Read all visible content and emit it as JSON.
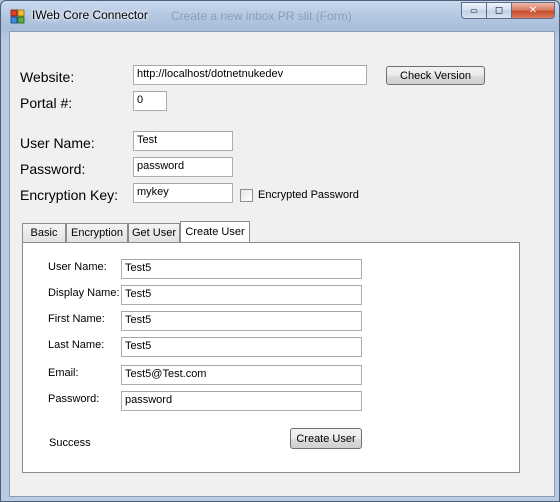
{
  "window": {
    "title": "IWeb Core Connector",
    "background_title": "Create a new inbox PR slit (Form)",
    "controls": {
      "minimize": "▭",
      "maximize": "◻",
      "close": "✕"
    }
  },
  "form": {
    "website_label": "Website:",
    "website_value": "http://localhost/dotnetnukedev",
    "check_version_label": "Check Version",
    "portal_label": "Portal #:",
    "portal_value": "0",
    "username_label": "User Name:",
    "username_value": "Test",
    "password_label": "Password:",
    "password_value": "password",
    "encryption_key_label": "Encryption Key:",
    "encryption_key_value": "mykey",
    "encrypted_password_label": "Encrypted Password",
    "encrypted_password_checked": false
  },
  "tabs": [
    {
      "label": "Basic",
      "active": false
    },
    {
      "label": "Encryption",
      "active": false
    },
    {
      "label": "Get User",
      "active": false
    },
    {
      "label": "Create User",
      "active": true
    }
  ],
  "create_user": {
    "username_label": "User Name:",
    "username_value": "Test5",
    "display_name_label": "Display Name:",
    "display_name_value": "Test5",
    "first_name_label": "First Name:",
    "first_name_value": "Test5",
    "last_name_label": "Last Name:",
    "last_name_value": "Test5",
    "email_label": "Email:",
    "email_value": "Test5@Test.com",
    "password_label": "Password:",
    "password_value": "password",
    "status_text": "Success",
    "create_button_label": "Create User"
  },
  "colors": {
    "titlebar": "#b5c8e2",
    "client_bg": "#f0f0f0",
    "close_button": "#c44a2a"
  }
}
